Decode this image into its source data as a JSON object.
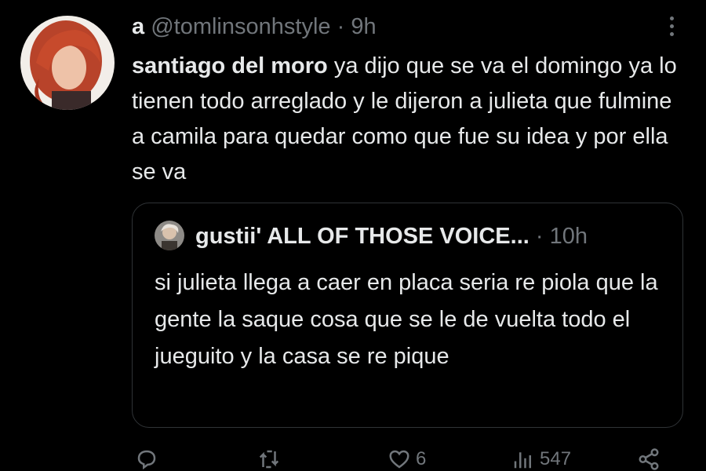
{
  "tweet": {
    "display_name": "a",
    "handle": "@tomlinsonhstyle",
    "separator": "·",
    "time": "9h",
    "mention": "santiago del moro",
    "text": " ya dijo que se va el domingo ya lo tienen todo arreglado y le dijeron a julieta que fulmine a camila para quedar como que fue su idea y por ella se va"
  },
  "quote": {
    "name": "gustii' ALL OF THOSE VOICE...",
    "separator": "·",
    "time": "10h",
    "text": "si julieta llega a caer en placa seria re piola que la gente la saque cosa que se le de vuelta todo el jueguito y la casa se re pique"
  },
  "actions": {
    "reply_icon": "reply-icon",
    "retweet_icon": "retweet-icon",
    "like_icon": "heart-icon",
    "likes": "6",
    "views_icon": "views-icon",
    "views": "547",
    "share_icon": "share-icon"
  },
  "colors": {
    "background": "#000000",
    "text": "#e7e9ea",
    "muted": "#71767b",
    "border": "#2f3336"
  }
}
